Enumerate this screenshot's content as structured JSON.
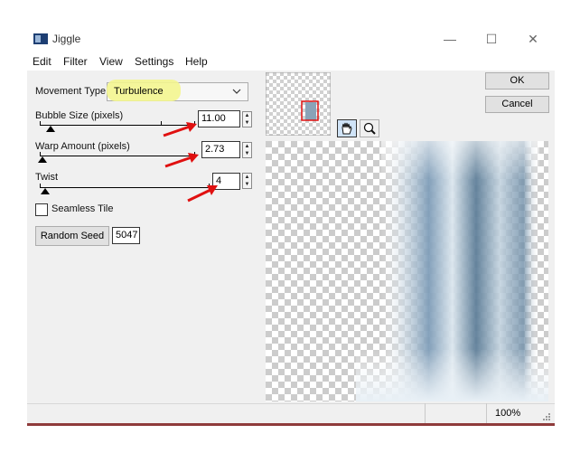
{
  "window": {
    "title": "Jiggle",
    "minimize_glyph": "—",
    "maximize_glyph": "☐",
    "close_glyph": "✕"
  },
  "menu": [
    "Edit",
    "Filter",
    "View",
    "Settings",
    "Help"
  ],
  "controls": {
    "movement_type_label": "Movement Type:",
    "movement_type_value": "Turbulence",
    "bubble_size_label": "Bubble Size (pixels)",
    "bubble_size_value": "11.00",
    "warp_amount_label": "Warp Amount (pixels)",
    "warp_amount_value": "2.73",
    "twist_label": "Twist",
    "twist_value": "4",
    "seamless_tile_label": "Seamless Tile",
    "seamless_tile_checked": false,
    "random_seed_label": "Random Seed",
    "random_seed_value": "5047"
  },
  "buttons": {
    "ok": "OK",
    "cancel": "Cancel"
  },
  "status": {
    "zoom": "100%"
  },
  "colors": {
    "highlight": "#f3f58f",
    "arrow": "#e01010",
    "panel": "#f0f0f0"
  }
}
